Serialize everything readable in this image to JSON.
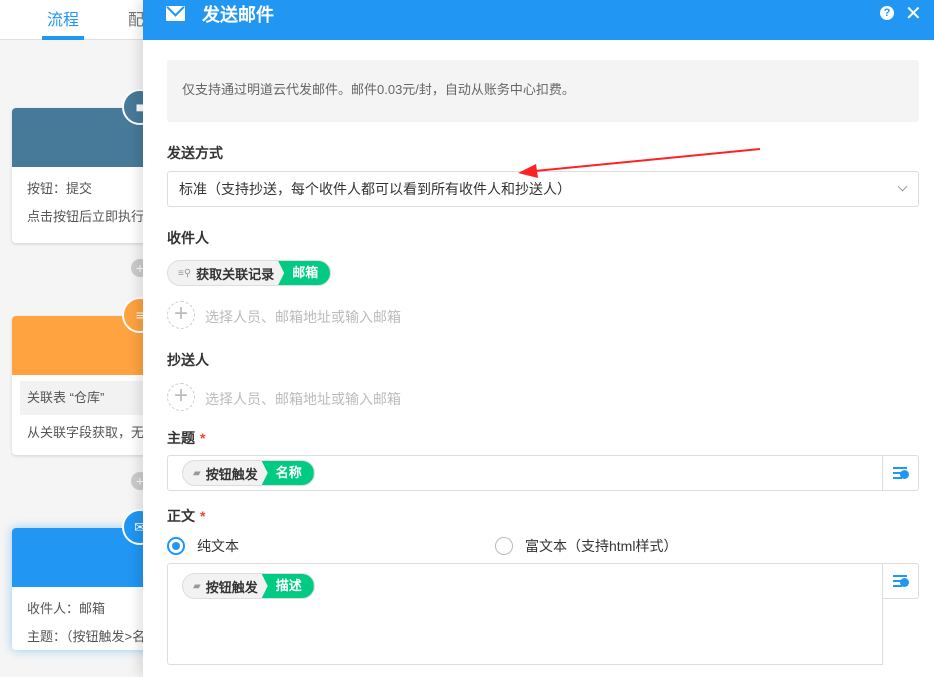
{
  "topbar": {
    "tabs": [
      {
        "label": "流程"
      },
      {
        "label": "配"
      }
    ]
  },
  "canvas": {
    "cards": [
      {
        "title": "按钮",
        "lines": [
          "按钮：提交",
          "点击按钮后立即执行"
        ],
        "color": "#477a99"
      },
      {
        "title": "获取关",
        "lines": [
          "关联表 “仓库”",
          "从关联字段获取，无"
        ],
        "color": "#ffa340"
      },
      {
        "title": "发送",
        "lines": [
          "收件人：邮箱",
          "主题：（按钮触发>名"
        ],
        "color": "#2196f3"
      }
    ]
  },
  "panel": {
    "title": "发送邮件",
    "help_icon": "?",
    "close_icon": "✕",
    "notice": "仅支持通过明道云代发邮件。邮件0.03元/封，自动从账务中心扣费。",
    "send_mode": {
      "label": "发送方式",
      "value": "标准（支持抄送，每个收件人都可以看到所有收件人和抄送人）"
    },
    "recipients": {
      "label": "收件人",
      "tag": {
        "node": "获取关联记录",
        "field": "邮箱"
      },
      "placeholder": "选择人员、邮箱地址或输入邮箱"
    },
    "cc": {
      "label": "抄送人",
      "placeholder": "选择人员、邮箱地址或输入邮箱"
    },
    "subject": {
      "label": "主题",
      "required": "*",
      "tag": {
        "node": "按钮触发",
        "field": "名称"
      }
    },
    "body": {
      "label": "正文",
      "required": "*",
      "options": [
        {
          "label": "纯文本",
          "selected": true
        },
        {
          "label": "富文本（支持html样式）",
          "selected": false
        }
      ],
      "tag": {
        "node": "按钮触发",
        "field": "描述"
      }
    }
  }
}
